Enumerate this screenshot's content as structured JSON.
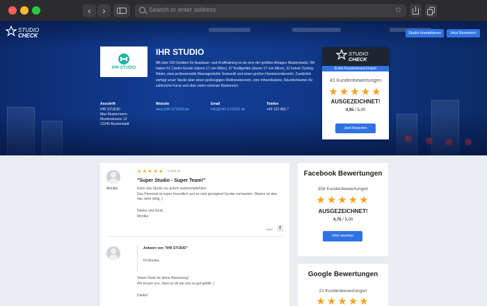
{
  "browser": {
    "back_glyph": "‹",
    "forward_glyph": "›",
    "address_placeholder": "Search or enter address",
    "bookmark_glyph": "☆"
  },
  "header": {
    "logo_text_top": "STUDIO",
    "logo_text_bottom": "CHECK",
    "contact_button": "Studio kontaktieren",
    "rate_button": "Jetzt Bewerten!"
  },
  "studio": {
    "logo_label": "IHR-STUDIO",
    "name": "IHR STUDIO",
    "description": "Mit über 150 Geräten für Ausdauer- und Krafttraining ist sie eine der größten Anlagen Musterstadts. Wir haben 51 Cardio-Geräte (davon 17 von Milon), 87 Kraftgeräte (davon 17 von Milon), 22 indoor Cycling-Räder, zwei professionelle Massagestühle Swissmill und einen großen Hantelcornbereich. Zusätzlich verfügt unser Studio über einen großzügigen Wellnessbereich, eine Infrarotkabine, Räumlichkeiten für zahlreiche Kurse und über einen schönen Barbereich."
  },
  "info": {
    "address": {
      "label": "Anschrift",
      "line1": "IHR STUDIO",
      "line2": "Max Mustermann",
      "line3": "Musterstrasse 12",
      "line4": "12345 Musterstadt"
    },
    "website": {
      "label": "Website",
      "value": "www.IHR-STUDIO.de"
    },
    "email": {
      "label": "Email",
      "value": "info@IHR-STUDIO.de"
    },
    "phone": {
      "label": "Telefon",
      "value": "+49 123 456 7"
    }
  },
  "rating_card": {
    "logo_text_top": "STUDIO",
    "logo_text_bottom": "CHECK",
    "band": "Echte Kundenbewertungen",
    "count": "42 Kundenbewertungen",
    "stars": "★★★★★",
    "verdict": "AUSGEZEICHNET!",
    "score": "4,95",
    "score_max": " / 5,00",
    "button": "Jetzt Bewerten"
  },
  "review": {
    "reviewer": "Monika",
    "stars": "★★★★★",
    "score": "5,00/5,00",
    "title": "\"Super Studio - Super Team!\"",
    "body_1": "Kann das Studio nur jedem weiterempfehlen!",
    "body_2": "Das Personal ist super freundlich und es sind genügend Geräte vorhanden, Warten ist also hier nicht nötig :)",
    "sign_1": "Danke und Gruß,",
    "sign_2": "Monika",
    "share_label": "Teilen",
    "share_icon": "f",
    "reply_title": "Antwort von \"IHR STUDIO\"",
    "reply_greeting": "Hi Monika,",
    "reply_body_1": "Vielen Dank für deine Bewertung!",
    "reply_body_2": "Wir freuen uns, dass es dir bei uns so gut gefällt :)",
    "reply_sign": "Danke!"
  },
  "facebook": {
    "title": "Facebook Bewertungen",
    "count": "358 Kundenbewertungen",
    "stars": "★★★★★",
    "verdict": "AUSGEZEICHNET!",
    "score": "4,70",
    "score_max": " / 5,00",
    "button": "Jetzt ansehen"
  },
  "google": {
    "title": "Google Bewertungen",
    "count": "21 Kundenbewertungen",
    "stars": "★★★★★"
  },
  "colors": {
    "accent": "#2f72e3",
    "star": "#f4a41b",
    "hero": "#123e95",
    "brand_teal": "#27b5a0"
  }
}
